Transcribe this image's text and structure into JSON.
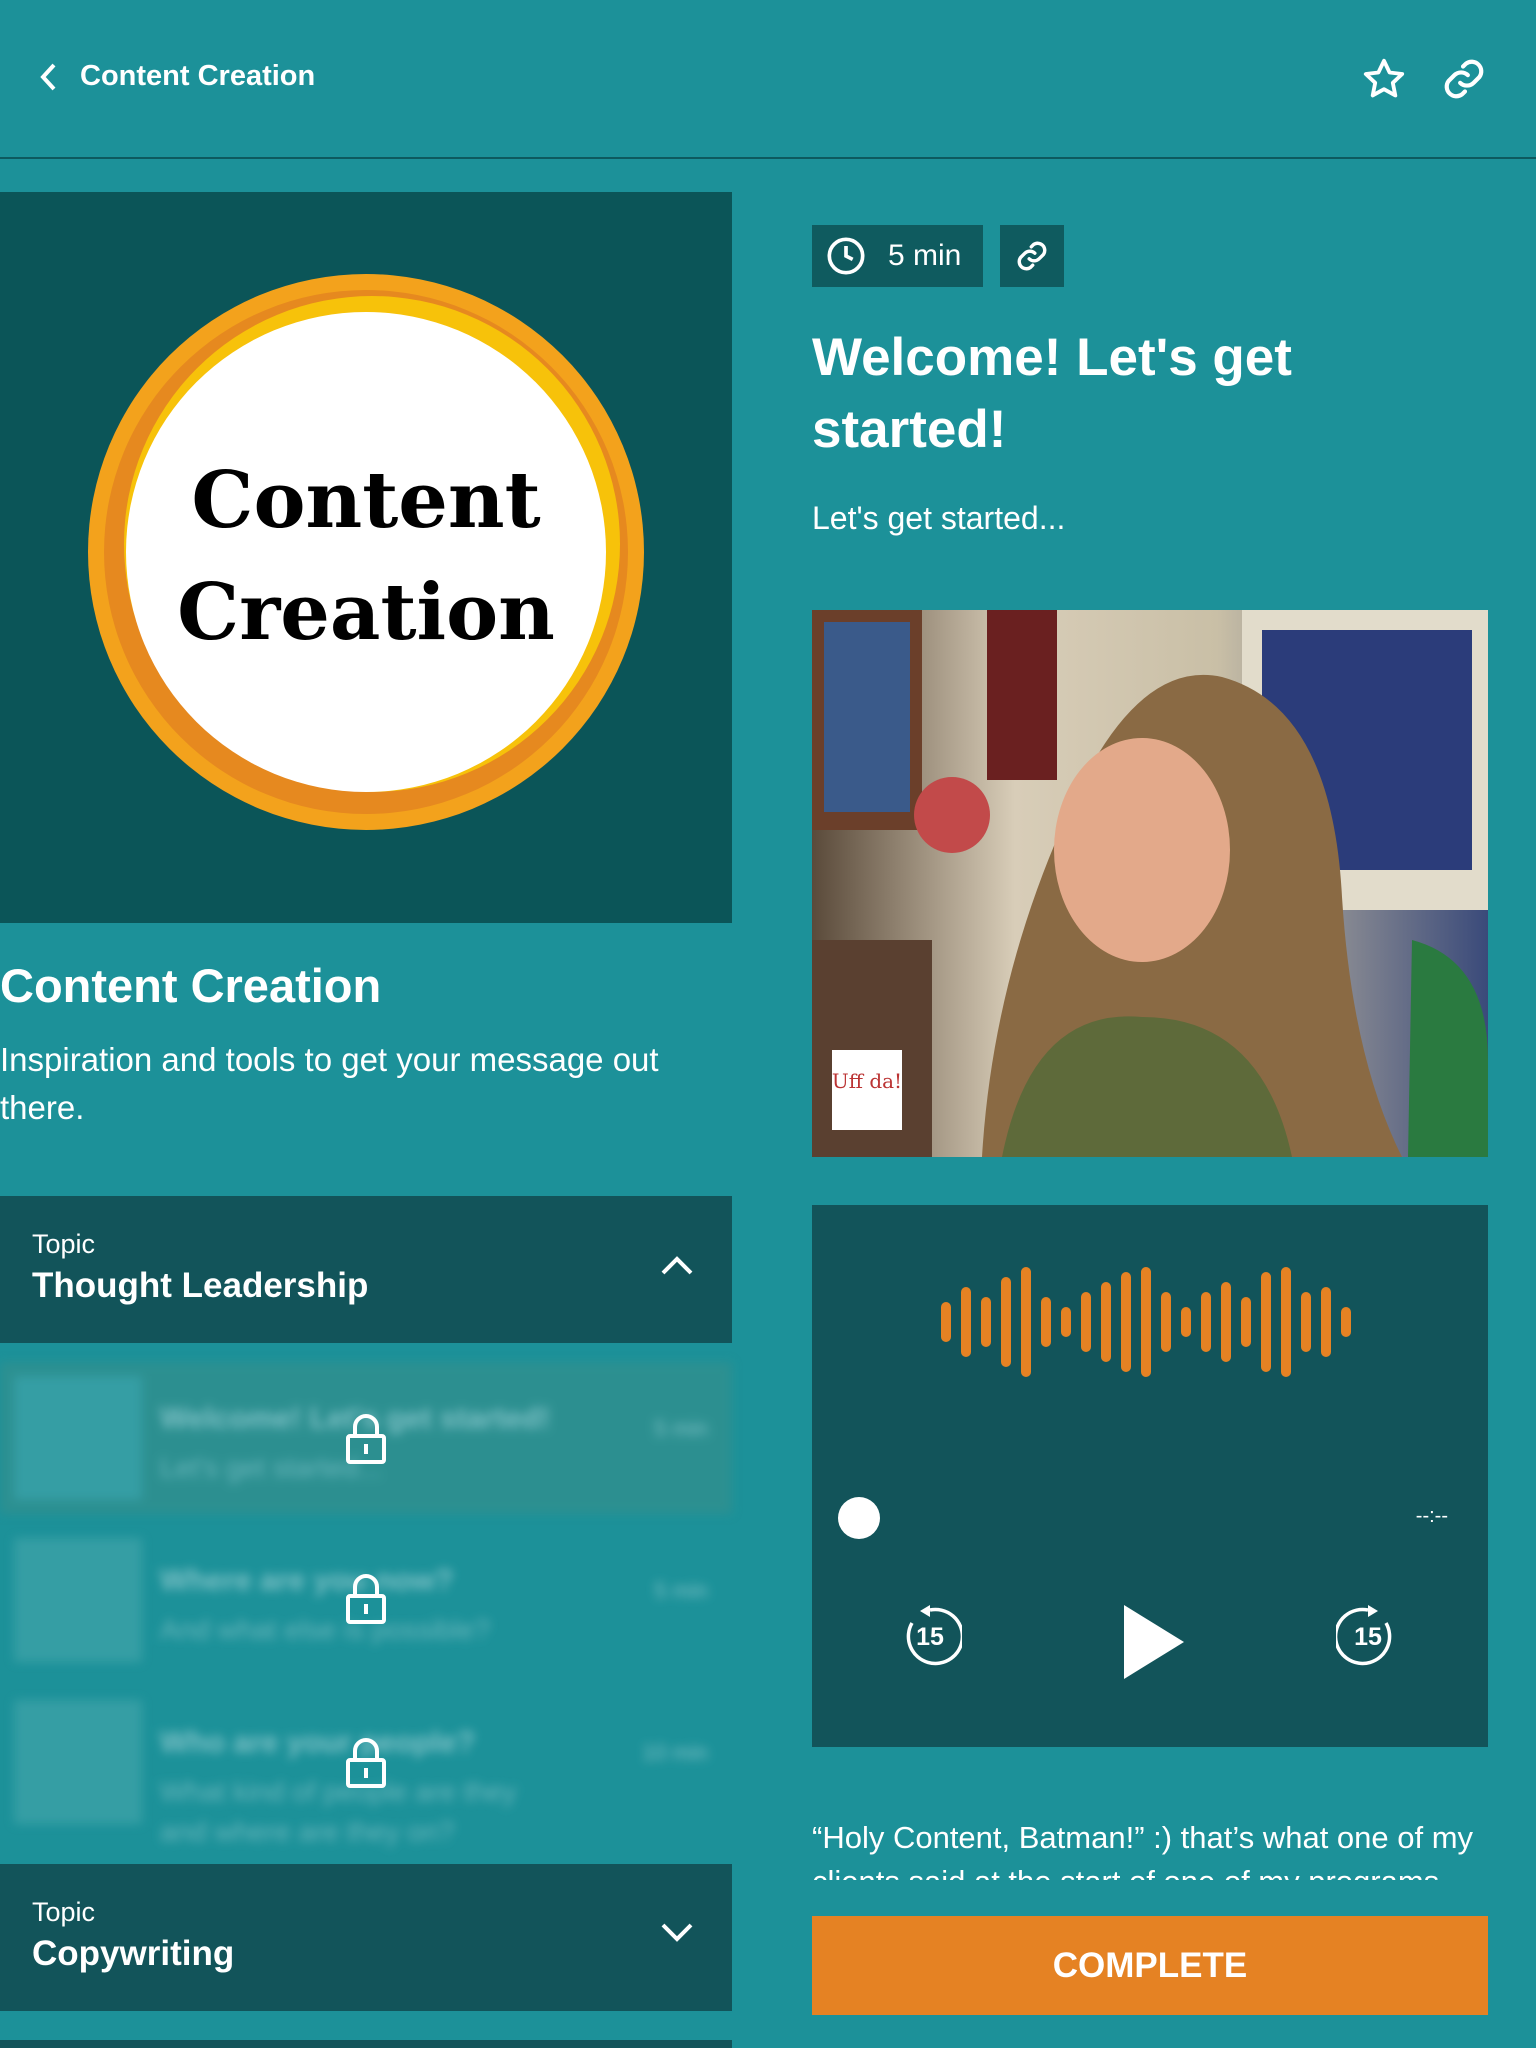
{
  "header": {
    "title": "Content Creation",
    "back_icon": "chevron-left-icon",
    "actions": [
      "star-icon",
      "link-icon"
    ]
  },
  "course": {
    "cover_text_line1": "Content",
    "cover_text_line2": "Creation",
    "title": "Content Creation",
    "description": "Inspiration and tools to get your message out there."
  },
  "topics": [
    {
      "label": "Topic",
      "name": "Thought Leadership",
      "expanded": true,
      "lessons": [
        {
          "title": "Welcome! Let's get started!",
          "subtitle": "Let's get started...",
          "duration": "5 min",
          "locked": true
        },
        {
          "title": "Where are you now?",
          "subtitle": "And what else is possible?",
          "duration": "5 min",
          "locked": true
        },
        {
          "title": "Who are your people?",
          "subtitle": "What kind of people are they and where are they on?",
          "duration": "10 min",
          "locked": true
        }
      ]
    },
    {
      "label": "Topic",
      "name": "Copywriting",
      "expanded": false
    }
  ],
  "lesson": {
    "duration": "5 min",
    "title": "Welcome! Let's get started!",
    "subtitle": "Let's get started...",
    "mug_text": "Uff da!",
    "audio": {
      "time": "--:--",
      "rewind": "15",
      "forward": "15",
      "progress": 0
    },
    "body": "“Holy Content, Batman!” :) that’s what one of my clients said at the start of one of my programs",
    "complete_label": "COMPLETE"
  },
  "colors": {
    "background": "#1c9199",
    "dark": "#12545a",
    "accent": "#e58223"
  }
}
